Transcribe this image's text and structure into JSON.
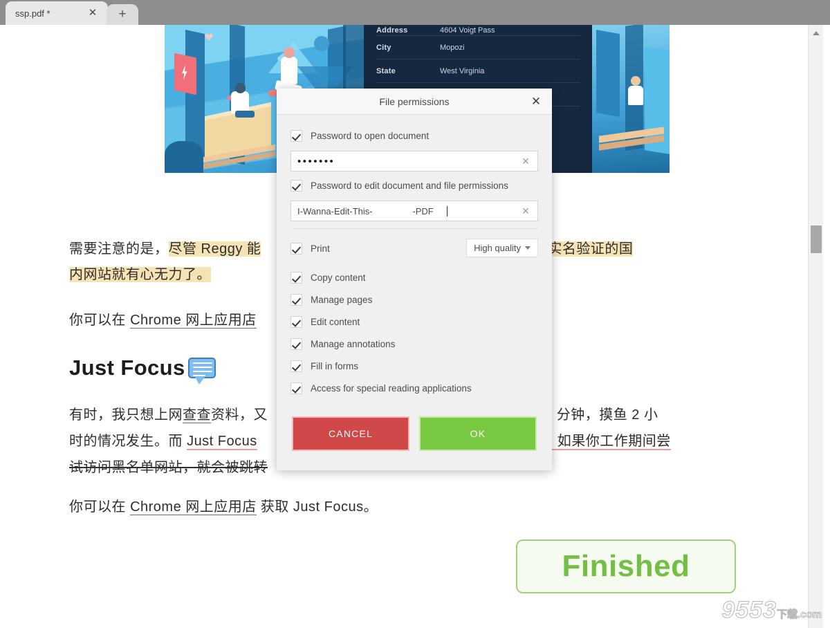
{
  "window": {
    "tab": {
      "title": "ssp.pdf *",
      "close_icon": "close-icon"
    },
    "new_tab_icon": "plus-icon"
  },
  "scrollbar": {
    "up_arrow_icon": "chevron-up-icon"
  },
  "document": {
    "table": {
      "rows": [
        {
          "key": "Address",
          "value": "4604 Voigt Pass"
        },
        {
          "key": "City",
          "value": "Mopozi"
        },
        {
          "key": "State",
          "value": "West Virginia"
        }
      ]
    },
    "paragraph1": {
      "plain_start": "需要注意的是，",
      "highlight_1": "尽管 Reggy 能",
      "highlight_2": "因此对付需要实名验证的国",
      "highlight_3": "内网站就有心无力了。"
    },
    "paragraph2": {
      "prefix": "你可以在 ",
      "link": "Chrome 网上应用店",
      "suffix": ""
    },
    "heading": {
      "text": "Just Focus",
      "icon": "comment-bubble-icon"
    },
    "paragraph3": {
      "l1_a": "有时，我只想上网",
      "l1_underline": "查查",
      "l1_b": "资料，又",
      "l1_right": "会有工作 5 分钟，摸鱼 2 小",
      "l2_a": "时的情况发生。而 ",
      "l2_red": "Just Focus",
      "l2_right": "心时间。如果你工作期间尝",
      "l3_strike": "试访问黑名单网站，就会被跳转"
    },
    "paragraph4": {
      "prefix": "你可以在 ",
      "link": "Chrome 网上应用店",
      "suffix": " 获取 Just Focus。"
    },
    "stamp": {
      "label": "Finished"
    },
    "watermark": {
      "main": "9553",
      "sub": "下载",
      "domain": ".com"
    }
  },
  "dialog": {
    "title": "File permissions",
    "close_icon": "close-icon",
    "open_password": {
      "checkbox_label": "Password to open document",
      "checked": true,
      "value": "•••••••",
      "clear_icon": "clear-icon"
    },
    "edit_password": {
      "checkbox_label": "Password to edit document and file permissions",
      "checked": true,
      "value": "I-Wanna-Edit-This-                -PDF",
      "clear_icon": "clear-icon"
    },
    "permissions": [
      {
        "label": "Print",
        "checked": true
      },
      {
        "label": "Copy content",
        "checked": true
      },
      {
        "label": "Manage pages",
        "checked": true
      },
      {
        "label": "Edit content",
        "checked": true
      },
      {
        "label": "Manage annotations",
        "checked": true
      },
      {
        "label": "Fill in forms",
        "checked": true
      },
      {
        "label": "Access for special reading applications",
        "checked": true
      }
    ],
    "print_quality": {
      "selected": "High quality",
      "chevron_icon": "chevron-down-icon"
    },
    "buttons": {
      "cancel": "CANCEL",
      "ok": "OK"
    },
    "colors": {
      "cancel_bg": "#d04848",
      "ok_bg": "#7ac943",
      "stamp_green": "#72bf44",
      "highlight": "#f6e3b4"
    }
  }
}
